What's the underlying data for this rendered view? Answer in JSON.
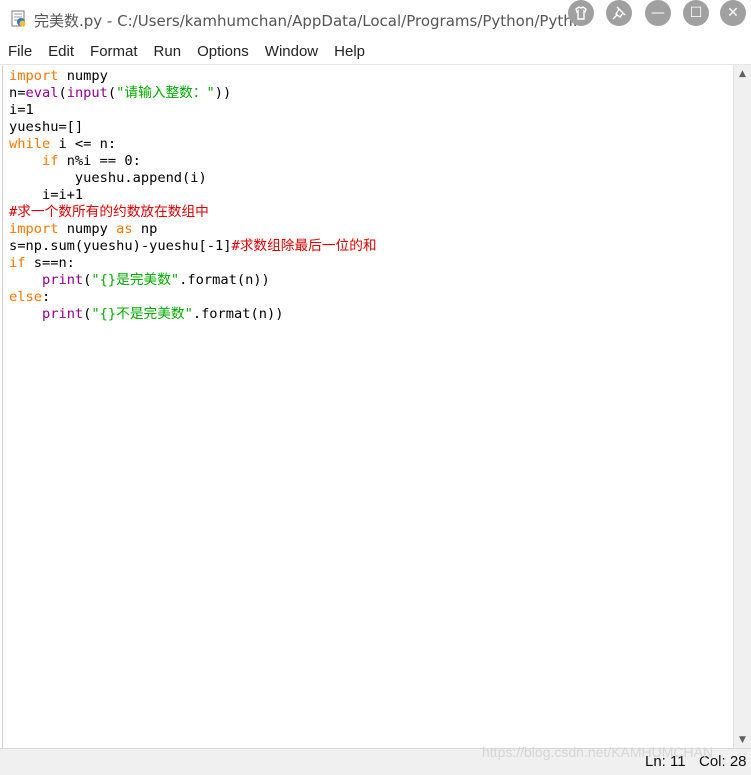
{
  "window": {
    "title": "完美数.py - C:/Users/kamhumchan/AppData/Local/Programs/Python/Pyth...",
    "controls": {
      "minimize": "—",
      "maximize": "☐",
      "close": "✕"
    }
  },
  "menu": [
    "File",
    "Edit",
    "Format",
    "Run",
    "Options",
    "Window",
    "Help"
  ],
  "code_lines": [
    [
      {
        "t": "import",
        "c": "kw"
      },
      {
        "t": " numpy",
        "c": ""
      }
    ],
    [
      {
        "t": "n=",
        "c": ""
      },
      {
        "t": "eval",
        "c": "bi"
      },
      {
        "t": "(",
        "c": ""
      },
      {
        "t": "input",
        "c": "bi"
      },
      {
        "t": "(",
        "c": ""
      },
      {
        "t": "\"请输入整数：\"",
        "c": "st"
      },
      {
        "t": "))",
        "c": ""
      }
    ],
    [
      {
        "t": "i=1",
        "c": ""
      }
    ],
    [
      {
        "t": "yueshu=[]",
        "c": ""
      }
    ],
    [
      {
        "t": "while",
        "c": "kw"
      },
      {
        "t": " i <= n:",
        "c": ""
      }
    ],
    [
      {
        "t": "    ",
        "c": ""
      },
      {
        "t": "if",
        "c": "kw"
      },
      {
        "t": " n%i == 0:",
        "c": ""
      }
    ],
    [
      {
        "t": "        yueshu.append(i)",
        "c": ""
      }
    ],
    [
      {
        "t": "    i=i+1",
        "c": ""
      }
    ],
    [
      {
        "t": "#求一个数所有的约数放在数组中",
        "c": "cm"
      }
    ],
    [
      {
        "t": "import",
        "c": "kw"
      },
      {
        "t": " numpy ",
        "c": ""
      },
      {
        "t": "as",
        "c": "kw"
      },
      {
        "t": " np",
        "c": ""
      }
    ],
    [
      {
        "t": "s=np.sum(yueshu)-yueshu[-1]",
        "c": ""
      },
      {
        "t": "#求数组除最后一位的和",
        "c": "cm"
      }
    ],
    [
      {
        "t": "if",
        "c": "kw"
      },
      {
        "t": " s==n:",
        "c": ""
      }
    ],
    [
      {
        "t": "    ",
        "c": ""
      },
      {
        "t": "print",
        "c": "bi"
      },
      {
        "t": "(",
        "c": ""
      },
      {
        "t": "\"{}是完美数\"",
        "c": "st"
      },
      {
        "t": ".format(n))",
        "c": ""
      }
    ],
    [
      {
        "t": "else",
        "c": "kw"
      },
      {
        "t": ":",
        "c": ""
      }
    ],
    [
      {
        "t": "    ",
        "c": ""
      },
      {
        "t": "print",
        "c": "bi"
      },
      {
        "t": "(",
        "c": ""
      },
      {
        "t": "\"{}不是完美数\"",
        "c": "st"
      },
      {
        "t": ".format(n))",
        "c": ""
      }
    ]
  ],
  "status": {
    "ln": "Ln: 11",
    "col": "Col: 28"
  },
  "watermark": "https://blog.csdn.net/KAMHUMCHAN",
  "colors": {
    "keyword": "#ff7700",
    "builtin": "#900090",
    "string": "#00aa00",
    "comment": "#dd0000"
  },
  "icons": {
    "app": "python-idle-icon",
    "extra_buttons": [
      "shirt-icon",
      "pin-icon"
    ]
  }
}
